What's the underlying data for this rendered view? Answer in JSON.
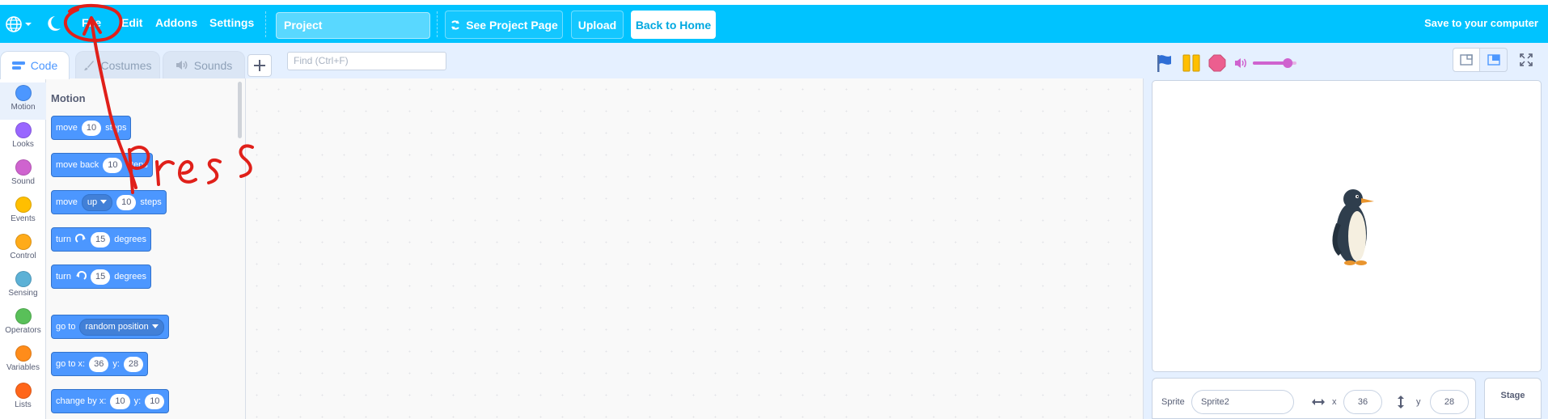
{
  "menubar": {
    "items": [
      "File",
      "Edit",
      "Addons",
      "Settings"
    ],
    "project_title": "Project",
    "see_project_page": "See Project Page",
    "upload": "Upload",
    "back_home": "Back to Home",
    "save_to_computer": "Save to your computer"
  },
  "tabs": [
    {
      "label": "Code",
      "icon": "code-icon"
    },
    {
      "label": "Costumes",
      "icon": "brush-icon"
    },
    {
      "label": "Sounds",
      "icon": "speaker-icon"
    }
  ],
  "find": {
    "placeholder": "Find (Ctrl+F)"
  },
  "categories": [
    {
      "label": "Motion",
      "color": "#4c97ff"
    },
    {
      "label": "Looks",
      "color": "#9966ff"
    },
    {
      "label": "Sound",
      "color": "#cf63cf"
    },
    {
      "label": "Events",
      "color": "#ffbf00"
    },
    {
      "label": "Control",
      "color": "#ffab19"
    },
    {
      "label": "Sensing",
      "color": "#5cb1d6"
    },
    {
      "label": "Operators",
      "color": "#59c059"
    },
    {
      "label": "Variables",
      "color": "#ff8c1a"
    },
    {
      "label": "Lists",
      "color": "#ff661a"
    }
  ],
  "palette": {
    "title": "Motion",
    "blocks": {
      "move": {
        "label": "move",
        "value": "10",
        "suffix": "steps"
      },
      "move_back": {
        "label": "move back",
        "value": "10",
        "suffix": "steps"
      },
      "move_dir": {
        "label": "move",
        "dropdown": "up",
        "value": "10",
        "suffix": "steps"
      },
      "turn_right": {
        "label": "turn",
        "value": "15",
        "suffix": "degrees"
      },
      "turn_left": {
        "label": "turn",
        "value": "15",
        "suffix": "degrees"
      },
      "go_to": {
        "label": "go to",
        "dropdown": "random position"
      },
      "go_to_xy": {
        "label": "go to x:",
        "x": "36",
        "ylabel": "y:",
        "y": "28"
      },
      "change_by": {
        "label": "change by x:",
        "x": "10",
        "ylabel": "y:",
        "y": "10"
      }
    }
  },
  "sprite_info": {
    "sprite_label": "Sprite",
    "sprite_name": "Sprite2",
    "x_label": "x",
    "x_value": "36",
    "y_label": "y",
    "y_value": "28"
  },
  "stage_tab": {
    "label": "Stage"
  },
  "volume_level": 0.8,
  "annotation": {
    "text": "press",
    "color": "#e0201a"
  }
}
